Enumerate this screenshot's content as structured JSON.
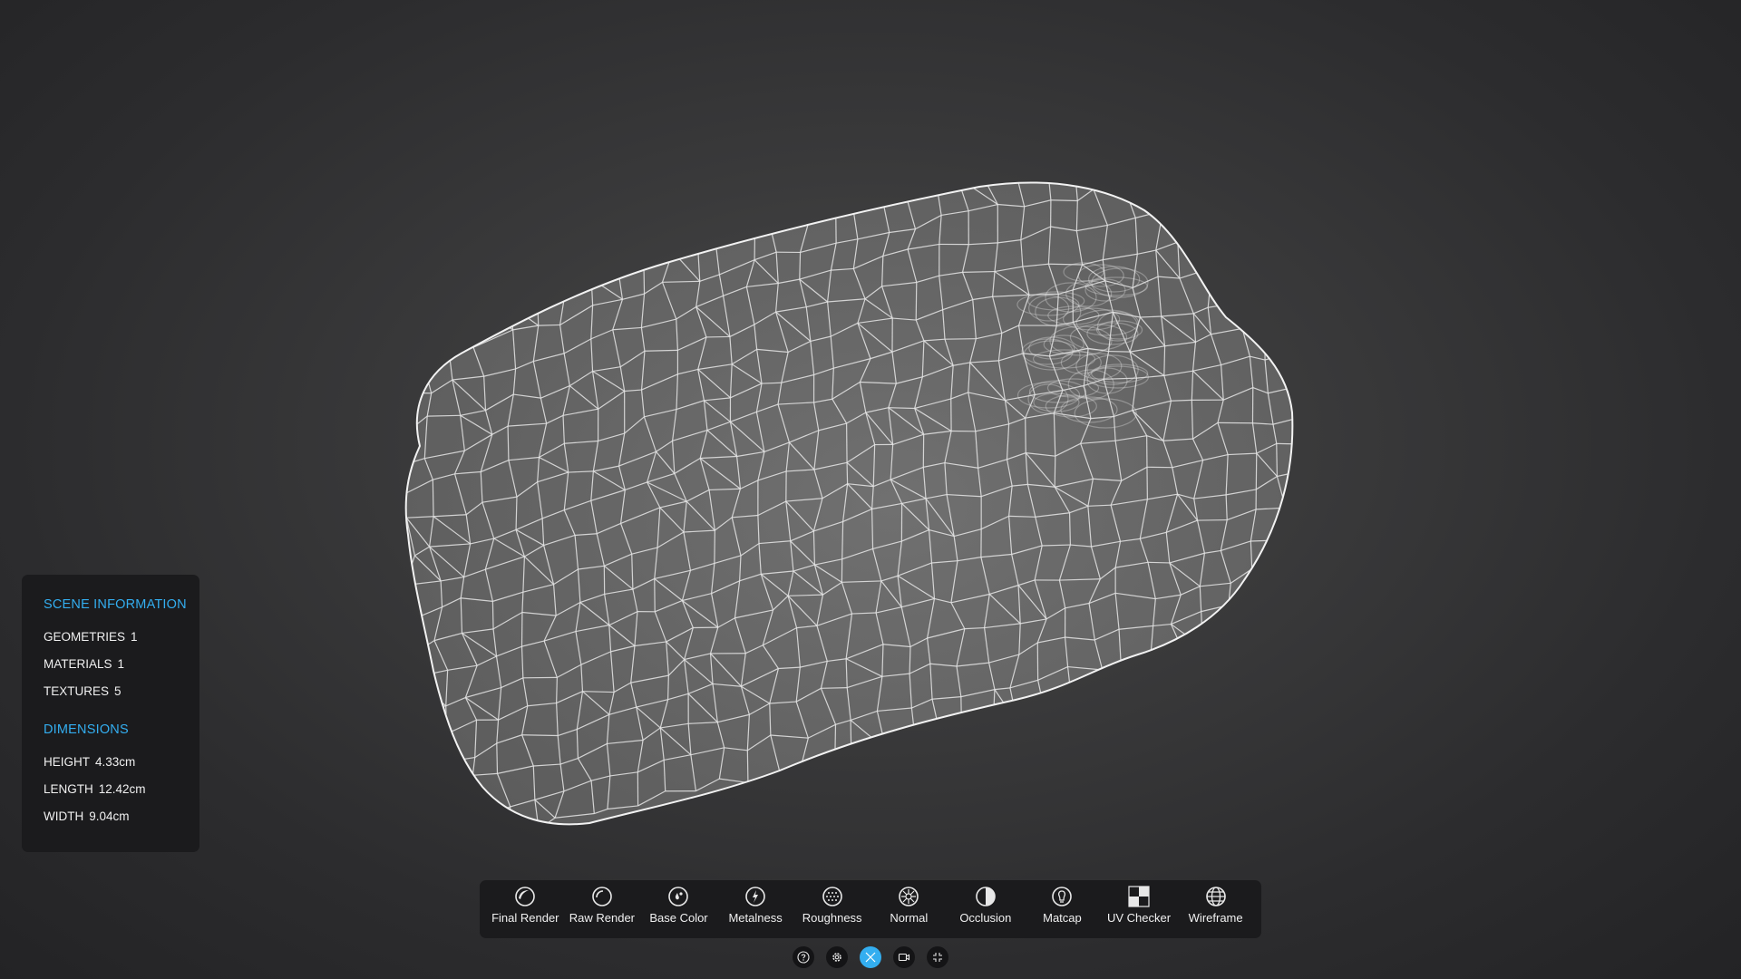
{
  "scene_info": {
    "heading": "SCENE INFORMATION",
    "rows": [
      {
        "label": "GEOMETRIES",
        "value": "1"
      },
      {
        "label": "MATERIALS",
        "value": "1"
      },
      {
        "label": "TEXTURES",
        "value": "5"
      }
    ]
  },
  "dimensions": {
    "heading": "DIMENSIONS",
    "rows": [
      {
        "label": "HEIGHT",
        "value": "4.33cm"
      },
      {
        "label": "LENGTH",
        "value": "12.42cm"
      },
      {
        "label": "WIDTH",
        "value": "9.04cm"
      }
    ]
  },
  "toolbar": {
    "items": [
      {
        "label": "Final Render",
        "icon": "final-render-icon"
      },
      {
        "label": "Raw Render",
        "icon": "raw-render-icon"
      },
      {
        "label": "Base Color",
        "icon": "base-color-icon"
      },
      {
        "label": "Metalness",
        "icon": "metalness-icon"
      },
      {
        "label": "Roughness",
        "icon": "roughness-icon"
      },
      {
        "label": "Normal",
        "icon": "normal-icon"
      },
      {
        "label": "Occlusion",
        "icon": "occlusion-icon"
      },
      {
        "label": "Matcap",
        "icon": "matcap-icon"
      },
      {
        "label": "UV Checker",
        "icon": "uv-checker-icon"
      },
      {
        "label": "Wireframe",
        "icon": "wireframe-icon",
        "active": true
      }
    ]
  },
  "bottom_buttons": [
    {
      "icon": "help-icon"
    },
    {
      "icon": "settings-icon"
    },
    {
      "icon": "expand-icon",
      "active": true
    },
    {
      "icon": "camera-icon"
    },
    {
      "icon": "collapse-icon"
    }
  ],
  "colors": {
    "accent": "#33aef0",
    "panel_bg": "#1b1b1d",
    "mesh_fill": "#6a6a6a",
    "wire": "#e6e6e6"
  }
}
